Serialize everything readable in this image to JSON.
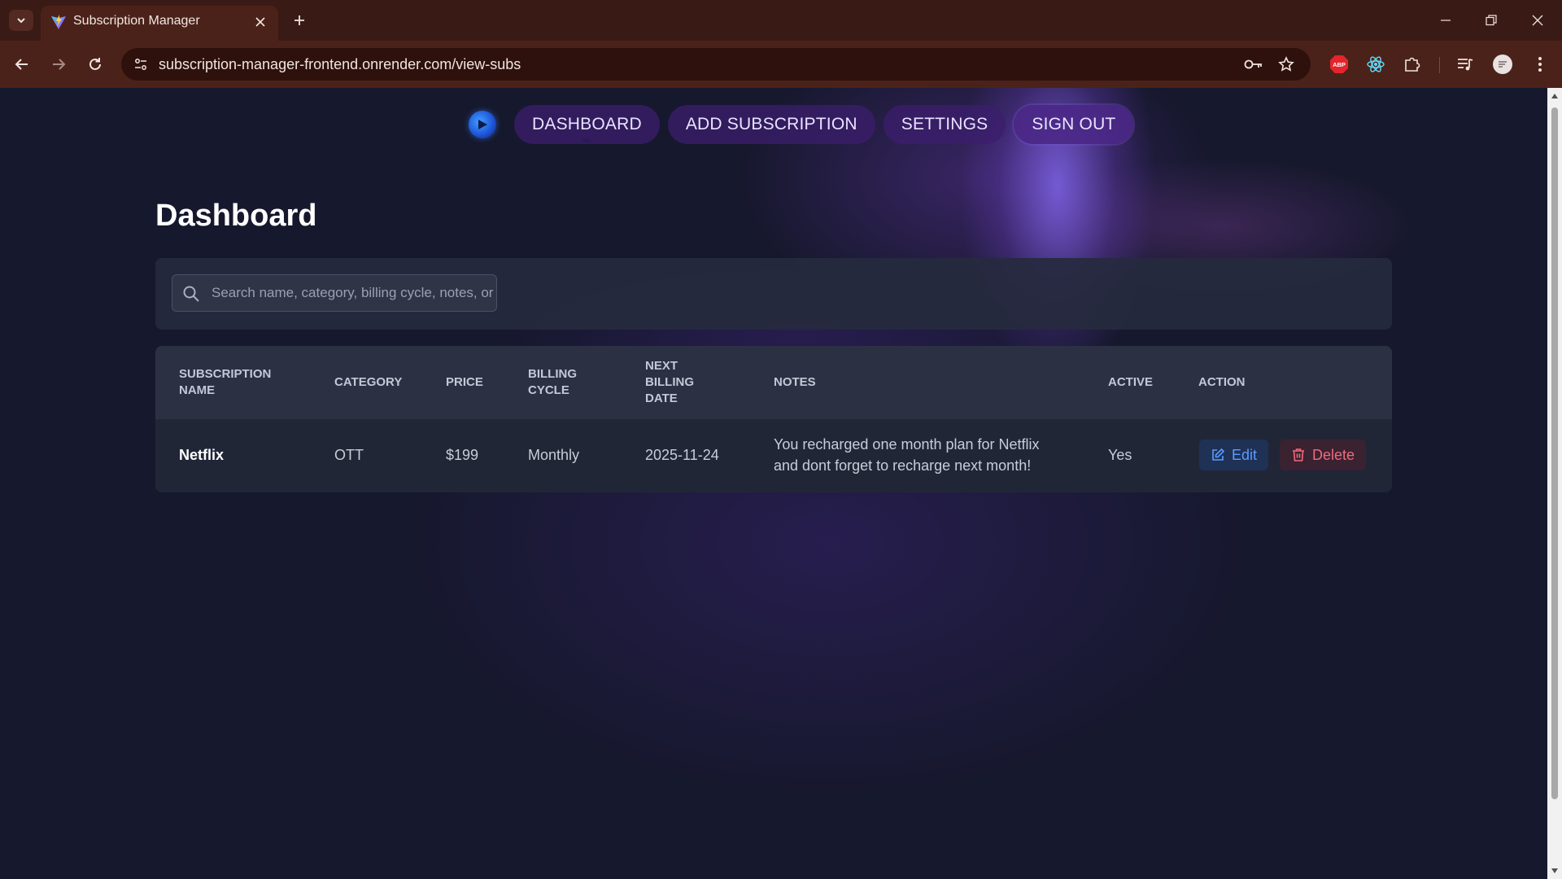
{
  "browser": {
    "tab_title": "Subscription Manager",
    "url": "subscription-manager-frontend.onrender.com/view-subs",
    "extensions": [
      "adblock-plus-icon",
      "react-devtools-icon",
      "extensions-puzzle-icon"
    ],
    "adblock_label": "ABP"
  },
  "navbar": {
    "items": [
      {
        "label": "DASHBOARD",
        "active": true
      },
      {
        "label": "ADD SUBSCRIPTION",
        "active": false
      },
      {
        "label": "SETTINGS",
        "active": false
      },
      {
        "label": "SIGN OUT",
        "active": false
      }
    ]
  },
  "page": {
    "title": "Dashboard"
  },
  "search": {
    "placeholder": "Search name, category, billing cycle, notes, or"
  },
  "table": {
    "headers": {
      "name": "SUBSCRIPTION NAME",
      "category": "CATEGORY",
      "price": "PRICE",
      "billing_cycle": "BILLING CYCLE",
      "next_billing_date": "NEXT BILLING DATE",
      "notes": "NOTES",
      "active": "ACTIVE",
      "action": "ACTION"
    },
    "rows": [
      {
        "name": "Netflix",
        "category": "OTT",
        "price": "$199",
        "billing_cycle": "Monthly",
        "next_billing_date": "2025-11-24",
        "notes": "You recharged one month plan for Netflix and dont forget to recharge next month!",
        "active": "Yes",
        "edit_label": "Edit",
        "delete_label": "Delete"
      }
    ]
  }
}
